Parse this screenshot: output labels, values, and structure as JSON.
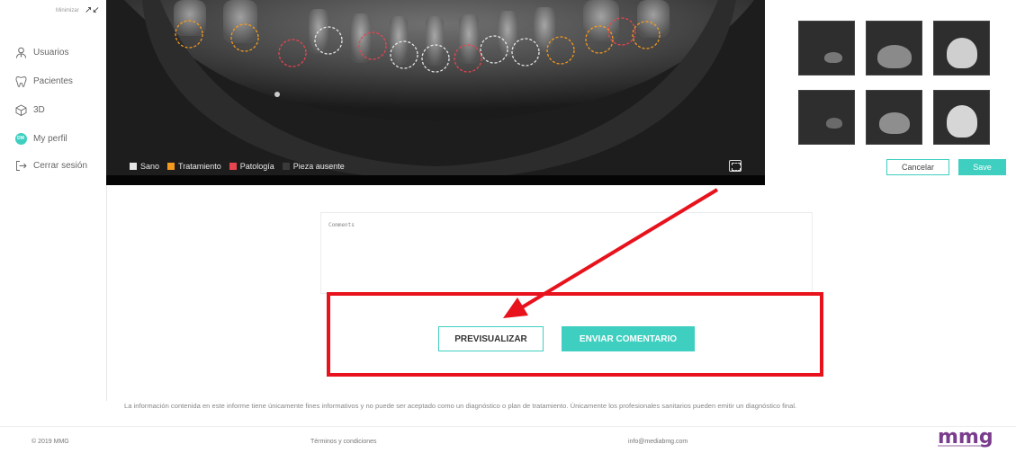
{
  "sidebar": {
    "minimize_label": "Minimizar",
    "items": [
      {
        "label": "Usuarios",
        "icon": "user-tie-icon"
      },
      {
        "label": "Pacientes",
        "icon": "tooth-icon"
      },
      {
        "label": "3D",
        "icon": "cube-icon"
      },
      {
        "label": "My perfil",
        "icon": "avatar-icon",
        "avatar_initials": "DM"
      },
      {
        "label": "Cerrar sesión",
        "icon": "logout-icon"
      }
    ]
  },
  "viewer": {
    "legend": [
      {
        "label": "Sano",
        "color": "#e6e6e6"
      },
      {
        "label": "Tratamiento",
        "color": "#f39a1f"
      },
      {
        "label": "Patología",
        "color": "#e8454f"
      },
      {
        "label": "Pieza ausente",
        "color": "#3a3a3a"
      }
    ]
  },
  "actions": {
    "cancel_label": "Cancelar",
    "save_label": "Save"
  },
  "comments": {
    "placeholder": "Comments"
  },
  "buttons": {
    "preview_label": "PREVISUALIZAR",
    "send_label": "ENVIAR COMENTARIO"
  },
  "disclaimer": "La información contenida en este informe tiene únicamente fines informativos y no puede ser aceptado como un diagnóstico o plan de tratamiento. Únicamente los profesionales sanitarios pueden emitir un diagnóstico final.",
  "footer": {
    "copyright": "© 2019 MMG",
    "terms": "Términos y condiciones",
    "email": "info@mediabmg.com",
    "logo_text": "mmg"
  },
  "colors": {
    "accent": "#3ecfc0",
    "annotation_red": "#e8121c"
  }
}
